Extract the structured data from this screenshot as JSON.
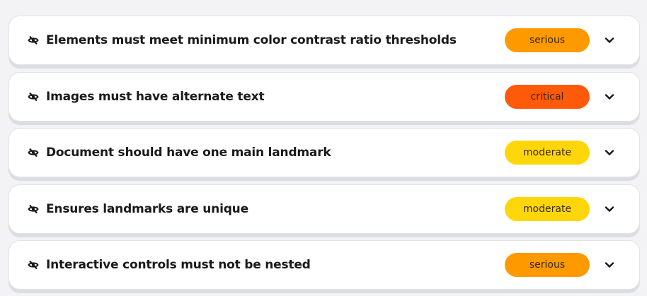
{
  "issues": [
    {
      "title": "Elements must meet minimum color contrast ratio thresholds",
      "severity": "serious",
      "color": "#ff9900"
    },
    {
      "title": "Images must have alternate text",
      "severity": "critical",
      "color": "#ff5a0a"
    },
    {
      "title": "Document should have one main landmark",
      "severity": "moderate",
      "color": "#ffd60a"
    },
    {
      "title": "Ensures landmarks are unique",
      "severity": "moderate",
      "color": "#ffd60a"
    },
    {
      "title": "Interactive controls must not be nested",
      "severity": "serious",
      "color": "#ff9900"
    }
  ],
  "icons": {
    "row": "eye-off-icon",
    "toggle": "chevron-down-icon"
  }
}
